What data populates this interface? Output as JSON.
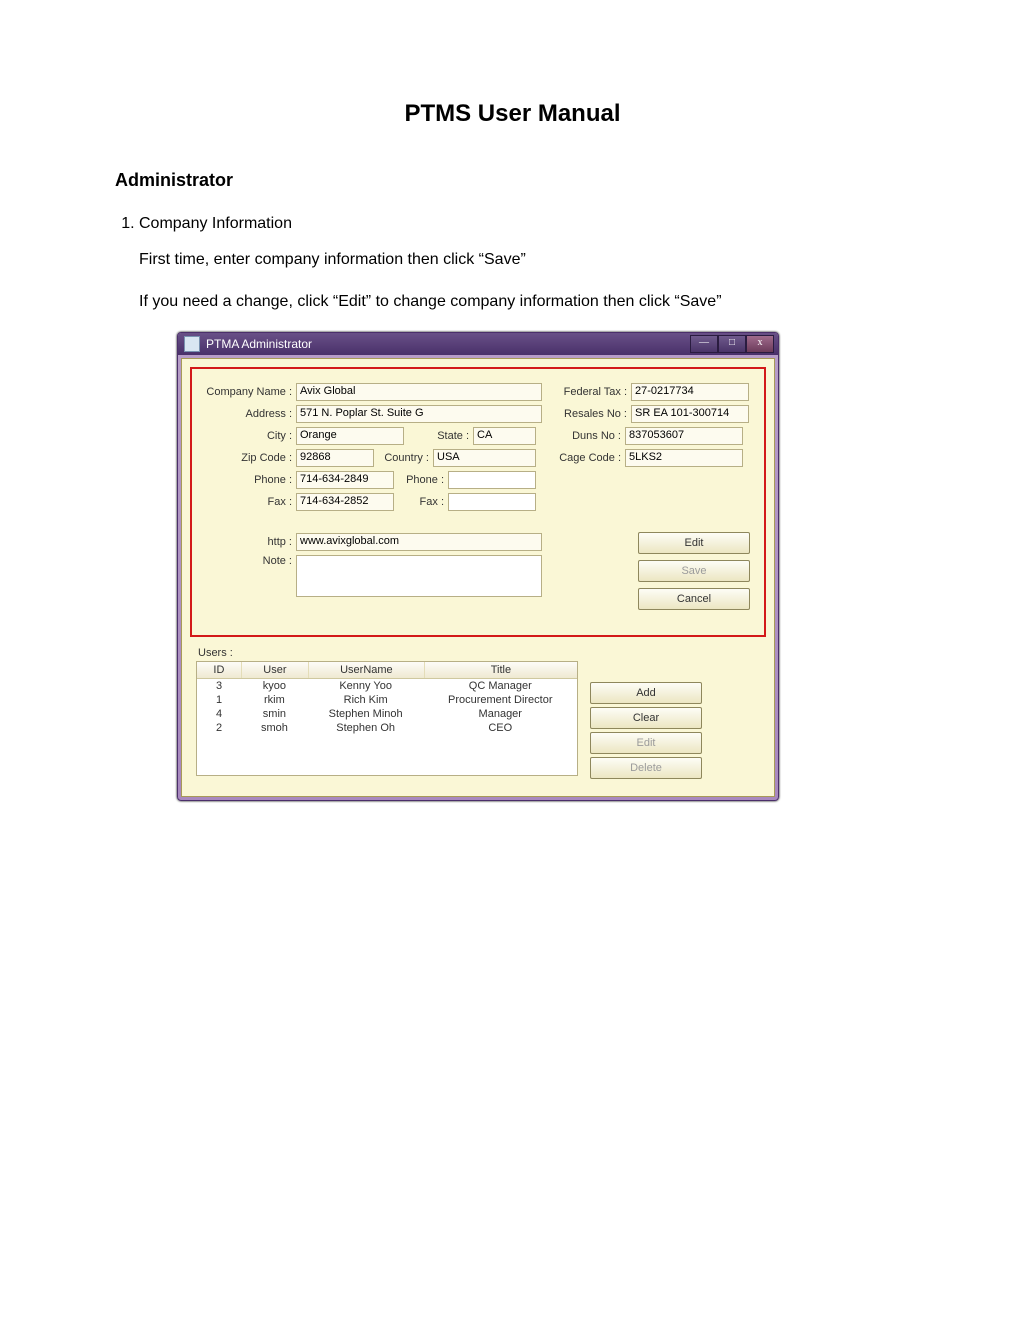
{
  "doc": {
    "title": "PTMS User Manual",
    "section_heading": "Administrator",
    "step_number": "1.",
    "step_label": "Company Information",
    "para1": "First time, enter company information then click “Save”",
    "para2": "If you need a change, click “Edit” to change company information then click “Save”"
  },
  "window": {
    "title": "PTMA Administrator",
    "min_glyph": "—",
    "max_glyph": "□",
    "close_glyph": "x"
  },
  "form": {
    "labels": {
      "company_name": "Company Name :",
      "address": "Address :",
      "city": "City :",
      "state": "State :",
      "zip": "Zip Code :",
      "country": "Country :",
      "phone1": "Phone :",
      "phone2": "Phone :",
      "fax1": "Fax :",
      "fax2": "Fax :",
      "http": "http :",
      "note": "Note :",
      "federal_tax": "Federal Tax :",
      "resales_no": "Resales No :",
      "duns_no": "Duns No :",
      "cage_code": "Cage Code :"
    },
    "values": {
      "company_name": "Avix Global",
      "address": "571 N. Poplar St. Suite G",
      "city": "Orange",
      "state": "CA",
      "zip": "92868",
      "country": "USA",
      "phone1": "714-634-2849",
      "phone2": "",
      "fax1": "714-634-2852",
      "fax2": "",
      "http": "www.avixglobal.com",
      "note": "",
      "federal_tax": "27-0217734",
      "resales_no": "SR EA 101-300714",
      "duns_no": "837053607",
      "cage_code": "5LKS2"
    },
    "buttons": {
      "edit": "Edit",
      "save": "Save",
      "cancel": "Cancel"
    }
  },
  "users": {
    "heading": "Users :",
    "columns": {
      "id": "ID",
      "user": "User",
      "username": "UserName",
      "title": "Title"
    },
    "rows": [
      {
        "id": "3",
        "user": "kyoo",
        "username": "Kenny Yoo",
        "title": "QC Manager"
      },
      {
        "id": "1",
        "user": "rkim",
        "username": "Rich Kim",
        "title": "Procurement Director"
      },
      {
        "id": "4",
        "user": "smin",
        "username": "Stephen Minoh",
        "title": "Manager"
      },
      {
        "id": "2",
        "user": "smoh",
        "username": "Stephen Oh",
        "title": "CEO"
      }
    ],
    "buttons": {
      "add": "Add",
      "clear": "Clear",
      "edit": "Edit",
      "delete": "Delete"
    }
  }
}
